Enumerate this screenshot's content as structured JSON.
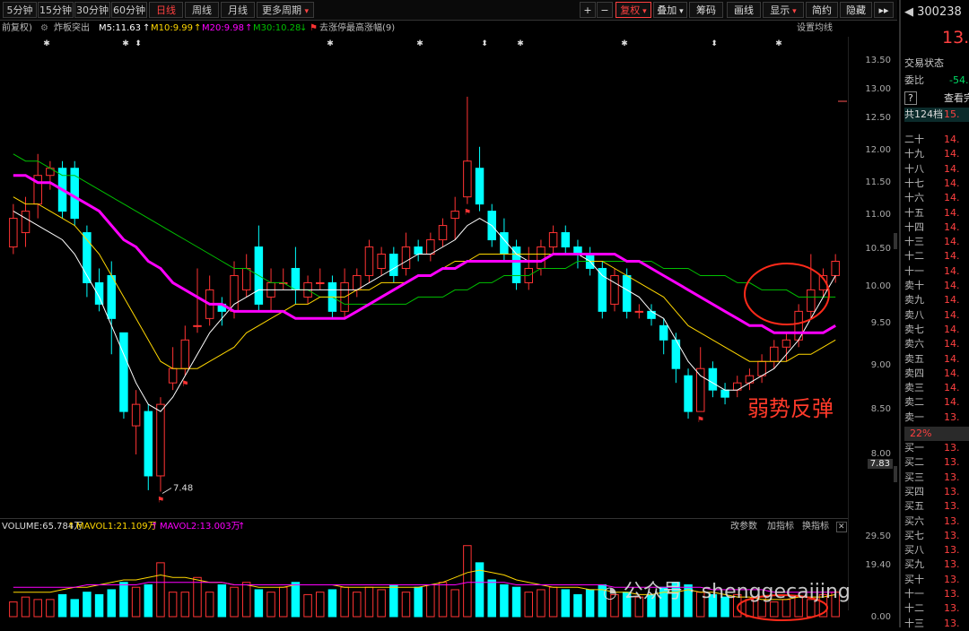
{
  "periods": [
    "5分钟",
    "15分钟",
    "30分钟",
    "60分钟",
    "日线",
    "周线",
    "月线",
    "更多周期"
  ],
  "active_period": "日线",
  "toolbar": {
    "plus": "+",
    "minus": "−",
    "fuquan": "复权",
    "overlay": "叠加",
    "chips": "筹码",
    "draw": "画线",
    "display": "显示",
    "simplify": "简约",
    "hide": "隐藏",
    "more": "▸▸"
  },
  "info": {
    "adjust": "前复权)",
    "stock_pick": "炸板突出",
    "ma5": "M5:11.63",
    "ma10": "M10:9.99",
    "ma20": "M20:9.98",
    "ma30": "M30:10.28",
    "limit_note": "去涨停最高涨幅(9)",
    "setting": "设置均线"
  },
  "colors": {
    "up": "#ff3333",
    "down": "#00ffff",
    "ma5": "#ffffff",
    "ma10": "#ffd700",
    "ma20": "#ff00ff",
    "ma30": "#00c000",
    "vol_ma1": "#ffd700",
    "vol_ma2": "#ff00ff"
  },
  "price_axis": [
    "13.50",
    "13.00",
    "12.50",
    "12.00",
    "11.50",
    "11.00",
    "10.50",
    "10.00",
    "9.50",
    "9.00",
    "8.50",
    "8.00"
  ],
  "current_price_tag": "7.83",
  "low_marker": "7.48",
  "volume": {
    "label": "VOLUME:65.784万",
    "mavol1": "MAVOL1:21.109万",
    "mavol2": "MAVOL2:13.003万",
    "axis": [
      "29.50",
      "19.40",
      "0.00"
    ],
    "controls": [
      "改参数",
      "加指标",
      "换指标"
    ]
  },
  "annotation": "弱势反弹",
  "watermark": "公众号 · shenggecaijing",
  "panel": {
    "code": "300238",
    "price": "13.",
    "trade_state": "交易状态",
    "weibi_label": "委比",
    "weibi_value": "-54.0",
    "help": "?",
    "view": "查看完",
    "levels_label": "共124档",
    "levels_value": "15.",
    "sell_rows": [
      {
        "label": "二十",
        "value": "14."
      },
      {
        "label": "十九",
        "value": "14."
      },
      {
        "label": "十八",
        "value": "14."
      },
      {
        "label": "十七",
        "value": "14."
      },
      {
        "label": "十六",
        "value": "14."
      },
      {
        "label": "十五",
        "value": "14."
      },
      {
        "label": "十四",
        "value": "14."
      },
      {
        "label": "十三",
        "value": "14."
      },
      {
        "label": "十二",
        "value": "14."
      },
      {
        "label": "十一",
        "value": "14."
      },
      {
        "label": "卖十",
        "value": "14."
      },
      {
        "label": "卖九",
        "value": "14."
      },
      {
        "label": "卖八",
        "value": "14."
      },
      {
        "label": "卖七",
        "value": "14."
      },
      {
        "label": "卖六",
        "value": "14."
      },
      {
        "label": "卖五",
        "value": "14."
      },
      {
        "label": "卖四",
        "value": "14."
      },
      {
        "label": "卖三",
        "value": "14."
      },
      {
        "label": "卖二",
        "value": "14."
      },
      {
        "label": "卖一",
        "value": "13."
      }
    ],
    "mid_pct": "22%",
    "buy_rows": [
      {
        "label": "买一",
        "value": "13."
      },
      {
        "label": "买二",
        "value": "13."
      },
      {
        "label": "买三",
        "value": "13."
      },
      {
        "label": "买四",
        "value": "13."
      },
      {
        "label": "买五",
        "value": "13."
      },
      {
        "label": "买六",
        "value": "13."
      },
      {
        "label": "买七",
        "value": "13."
      },
      {
        "label": "买八",
        "value": "13."
      },
      {
        "label": "买九",
        "value": "13."
      },
      {
        "label": "买十",
        "value": "13."
      },
      {
        "label": "十一",
        "value": "13."
      },
      {
        "label": "十二",
        "value": "13."
      },
      {
        "label": "十三",
        "value": "13."
      }
    ]
  },
  "chart_data": {
    "type": "candlestick",
    "ylim": [
      7.4,
      13.6
    ],
    "candles": [
      {
        "o": 10.9,
        "c": 11.3,
        "h": 11.5,
        "l": 10.8
      },
      {
        "o": 11.1,
        "c": 11.4,
        "h": 11.6,
        "l": 10.9
      },
      {
        "o": 11.5,
        "c": 11.9,
        "h": 12.2,
        "l": 11.3
      },
      {
        "o": 11.9,
        "c": 12.0,
        "h": 12.1,
        "l": 11.7
      },
      {
        "o": 12.0,
        "c": 11.4,
        "h": 12.1,
        "l": 11.3
      },
      {
        "o": 12.0,
        "c": 11.3,
        "h": 12.1,
        "l": 11.2
      },
      {
        "o": 11.1,
        "c": 10.4,
        "h": 11.2,
        "l": 10.2
      },
      {
        "o": 10.4,
        "c": 10.1,
        "h": 10.6,
        "l": 10.0
      },
      {
        "o": 10.5,
        "c": 9.9,
        "h": 10.7,
        "l": 9.4
      },
      {
        "o": 9.7,
        "c": 8.6,
        "h": 9.7,
        "l": 8.5
      },
      {
        "o": 8.4,
        "c": 8.7,
        "h": 8.9,
        "l": 8.0
      },
      {
        "o": 8.6,
        "c": 7.7,
        "h": 8.7,
        "l": 7.5
      },
      {
        "o": 7.7,
        "c": 8.7,
        "h": 8.8,
        "l": 7.48
      },
      {
        "o": 9.0,
        "c": 9.2,
        "h": 9.5,
        "l": 8.9
      },
      {
        "o": 9.2,
        "c": 9.6,
        "h": 9.8,
        "l": 9.1
      },
      {
        "o": 9.8,
        "c": 9.8,
        "h": 10.6,
        "l": 9.7
      },
      {
        "o": 9.9,
        "c": 10.3,
        "h": 10.5,
        "l": 9.8
      },
      {
        "o": 10.1,
        "c": 10.0,
        "h": 10.2,
        "l": 9.8
      },
      {
        "o": 10.0,
        "c": 10.5,
        "h": 10.7,
        "l": 9.9
      },
      {
        "o": 10.3,
        "c": 10.6,
        "h": 10.8,
        "l": 10.2
      },
      {
        "o": 10.9,
        "c": 10.1,
        "h": 11.2,
        "l": 10.0
      },
      {
        "o": 10.2,
        "c": 10.4,
        "h": 10.6,
        "l": 10.0
      },
      {
        "o": 10.4,
        "c": 10.4,
        "h": 10.6,
        "l": 10.3
      },
      {
        "o": 10.6,
        "c": 10.3,
        "h": 10.9,
        "l": 10.1
      },
      {
        "o": 10.2,
        "c": 10.4,
        "h": 10.5,
        "l": 10.1
      },
      {
        "o": 10.4,
        "c": 10.4,
        "h": 10.6,
        "l": 10.3
      },
      {
        "o": 10.4,
        "c": 10.0,
        "h": 10.5,
        "l": 9.9
      },
      {
        "o": 10.0,
        "c": 10.4,
        "h": 10.6,
        "l": 9.9
      },
      {
        "o": 10.3,
        "c": 10.5,
        "h": 10.6,
        "l": 10.2
      },
      {
        "o": 10.5,
        "c": 10.9,
        "h": 11.0,
        "l": 10.4
      },
      {
        "o": 10.6,
        "c": 10.8,
        "h": 10.9,
        "l": 10.5
      },
      {
        "o": 10.8,
        "c": 10.5,
        "h": 10.9,
        "l": 10.4
      },
      {
        "o": 10.6,
        "c": 10.9,
        "h": 11.1,
        "l": 10.5
      },
      {
        "o": 10.9,
        "c": 10.8,
        "h": 11.0,
        "l": 10.7
      },
      {
        "o": 10.8,
        "c": 11.0,
        "h": 11.1,
        "l": 10.7
      },
      {
        "o": 11.0,
        "c": 11.2,
        "h": 11.3,
        "l": 10.9
      },
      {
        "o": 11.3,
        "c": 11.4,
        "h": 11.6,
        "l": 11.0
      },
      {
        "o": 11.6,
        "c": 12.1,
        "h": 13.0,
        "l": 11.5
      },
      {
        "o": 12.0,
        "c": 11.5,
        "h": 12.3,
        "l": 11.4
      },
      {
        "o": 11.4,
        "c": 11.0,
        "h": 11.5,
        "l": 10.9
      },
      {
        "o": 11.1,
        "c": 10.8,
        "h": 11.3,
        "l": 10.7
      },
      {
        "o": 10.9,
        "c": 10.4,
        "h": 11.0,
        "l": 10.3
      },
      {
        "o": 10.4,
        "c": 10.6,
        "h": 10.9,
        "l": 10.3
      },
      {
        "o": 10.6,
        "c": 10.9,
        "h": 11.0,
        "l": 10.5
      },
      {
        "o": 10.9,
        "c": 11.1,
        "h": 11.2,
        "l": 10.8
      },
      {
        "o": 11.1,
        "c": 10.9,
        "h": 11.2,
        "l": 10.8
      },
      {
        "o": 10.9,
        "c": 10.8,
        "h": 11.0,
        "l": 10.6
      },
      {
        "o": 10.8,
        "c": 10.6,
        "h": 10.9,
        "l": 10.5
      },
      {
        "o": 10.6,
        "c": 10.0,
        "h": 10.7,
        "l": 9.9
      },
      {
        "o": 10.1,
        "c": 10.5,
        "h": 10.6,
        "l": 10.0
      },
      {
        "o": 10.5,
        "c": 10.0,
        "h": 10.6,
        "l": 9.9
      },
      {
        "o": 10.0,
        "c": 10.0,
        "h": 10.1,
        "l": 9.9
      },
      {
        "o": 10.0,
        "c": 9.9,
        "h": 10.1,
        "l": 9.8
      },
      {
        "o": 9.8,
        "c": 9.6,
        "h": 9.9,
        "l": 9.4
      },
      {
        "o": 9.6,
        "c": 9.2,
        "h": 9.7,
        "l": 9.0
      },
      {
        "o": 9.1,
        "c": 8.6,
        "h": 9.2,
        "l": 8.5
      },
      {
        "o": 8.6,
        "c": 9.2,
        "h": 9.5,
        "l": 8.6
      },
      {
        "o": 9.2,
        "c": 8.9,
        "h": 9.3,
        "l": 8.8
      },
      {
        "o": 8.9,
        "c": 8.8,
        "h": 9.0,
        "l": 8.7
      },
      {
        "o": 8.9,
        "c": 9.0,
        "h": 9.1,
        "l": 8.8
      },
      {
        "o": 9.0,
        "c": 9.1,
        "h": 9.2,
        "l": 8.9
      },
      {
        "o": 9.1,
        "c": 9.3,
        "h": 9.4,
        "l": 9.0
      },
      {
        "o": 9.3,
        "c": 9.5,
        "h": 9.6,
        "l": 9.2
      },
      {
        "o": 9.5,
        "c": 9.6,
        "h": 9.7,
        "l": 9.3
      },
      {
        "o": 9.6,
        "c": 10.0,
        "h": 10.1,
        "l": 9.5
      },
      {
        "o": 10.0,
        "c": 10.3,
        "h": 10.8,
        "l": 9.9
      },
      {
        "o": 10.3,
        "c": 10.5,
        "h": 10.6,
        "l": 10.2
      },
      {
        "o": 10.5,
        "c": 10.7,
        "h": 10.8,
        "l": 10.4
      }
    ],
    "ma_series": [
      {
        "name": "M5",
        "values": [
          11.4,
          11.3,
          11.2,
          11.1,
          11.0,
          10.8,
          10.5,
          10.2,
          9.8,
          9.4,
          9.0,
          8.7,
          8.6,
          8.8,
          9.1,
          9.4,
          9.7,
          9.9,
          10.1,
          10.2,
          10.3,
          10.3,
          10.3,
          10.3,
          10.3,
          10.3,
          10.3,
          10.3,
          10.3,
          10.4,
          10.5,
          10.6,
          10.7,
          10.8,
          10.8,
          10.9,
          11.0,
          11.2,
          11.3,
          11.2,
          11.0,
          10.8,
          10.7,
          10.7,
          10.8,
          10.8,
          10.8,
          10.7,
          10.5,
          10.4,
          10.3,
          10.2,
          10.0,
          9.9,
          9.6,
          9.3,
          9.1,
          9.0,
          8.9,
          8.9,
          9.0,
          9.1,
          9.2,
          9.4,
          9.6,
          9.9,
          10.2,
          10.5
        ]
      },
      {
        "name": "M10",
        "values": [
          11.6,
          11.5,
          11.5,
          11.4,
          11.3,
          11.2,
          11.0,
          10.8,
          10.5,
          10.2,
          9.9,
          9.6,
          9.3,
          9.2,
          9.2,
          9.2,
          9.3,
          9.4,
          9.5,
          9.7,
          9.8,
          9.9,
          10.0,
          10.1,
          10.1,
          10.2,
          10.2,
          10.2,
          10.3,
          10.3,
          10.4,
          10.4,
          10.4,
          10.5,
          10.5,
          10.6,
          10.7,
          10.7,
          10.8,
          10.8,
          10.8,
          10.8,
          10.8,
          10.8,
          10.8,
          10.8,
          10.8,
          10.7,
          10.7,
          10.6,
          10.5,
          10.4,
          10.3,
          10.2,
          10.0,
          9.8,
          9.7,
          9.6,
          9.5,
          9.4,
          9.3,
          9.3,
          9.3,
          9.3,
          9.4,
          9.4,
          9.5,
          9.6
        ]
      },
      {
        "name": "M20",
        "values": [
          11.9,
          11.9,
          11.8,
          11.8,
          11.7,
          11.6,
          11.5,
          11.4,
          11.2,
          11.0,
          10.9,
          10.7,
          10.6,
          10.4,
          10.3,
          10.2,
          10.1,
          10.1,
          10.0,
          10.0,
          10.0,
          10.0,
          10.0,
          9.9,
          9.9,
          9.9,
          9.9,
          9.9,
          10.0,
          10.1,
          10.2,
          10.3,
          10.4,
          10.5,
          10.5,
          10.6,
          10.6,
          10.7,
          10.7,
          10.7,
          10.7,
          10.7,
          10.7,
          10.7,
          10.8,
          10.8,
          10.8,
          10.8,
          10.8,
          10.8,
          10.7,
          10.7,
          10.6,
          10.5,
          10.4,
          10.3,
          10.2,
          10.1,
          10.0,
          9.9,
          9.8,
          9.8,
          9.7,
          9.7,
          9.7,
          9.7,
          9.7,
          9.8
        ]
      },
      {
        "name": "M30",
        "values": [
          12.2,
          12.1,
          12.1,
          12.0,
          11.9,
          11.9,
          11.8,
          11.7,
          11.6,
          11.5,
          11.4,
          11.3,
          11.2,
          11.1,
          11.0,
          10.9,
          10.8,
          10.7,
          10.6,
          10.6,
          10.5,
          10.4,
          10.4,
          10.3,
          10.3,
          10.2,
          10.2,
          10.1,
          10.1,
          10.1,
          10.1,
          10.1,
          10.1,
          10.2,
          10.2,
          10.2,
          10.3,
          10.3,
          10.4,
          10.4,
          10.5,
          10.5,
          10.5,
          10.6,
          10.6,
          10.6,
          10.7,
          10.7,
          10.7,
          10.7,
          10.7,
          10.7,
          10.7,
          10.6,
          10.6,
          10.6,
          10.5,
          10.5,
          10.5,
          10.4,
          10.4,
          10.3,
          10.3,
          10.3,
          10.2,
          10.2,
          10.2,
          10.2
        ]
      }
    ],
    "volumes": [
      6,
      8,
      7,
      7,
      9,
      7,
      10,
      9,
      11,
      14,
      12,
      13,
      22,
      10,
      10,
      16,
      10,
      13,
      12,
      14,
      11,
      10,
      12,
      14,
      9,
      10,
      11,
      12,
      10,
      12,
      11,
      13,
      10,
      12,
      13,
      14,
      11,
      29,
      22,
      15,
      13,
      12,
      10,
      11,
      12,
      11,
      9,
      11,
      13,
      9,
      10,
      8,
      9,
      12,
      14,
      13,
      10,
      9,
      8,
      9,
      7,
      8,
      6,
      7,
      8,
      7,
      9,
      10
    ],
    "mavol1": [
      10,
      10,
      10,
      10,
      11,
      12,
      12,
      13,
      14,
      15,
      15,
      16,
      17,
      16,
      16,
      15,
      14,
      14,
      13,
      13,
      12,
      12,
      12,
      13,
      13,
      13,
      13,
      12,
      12,
      12,
      12,
      12,
      12,
      12,
      13,
      14,
      16,
      18,
      19,
      18,
      17,
      15,
      14,
      13,
      12,
      12,
      12,
      11,
      11,
      10,
      10,
      9,
      9,
      10,
      10,
      11,
      10,
      10,
      9,
      8,
      8,
      7,
      7,
      7,
      8,
      8,
      8,
      9
    ],
    "mavol2": [
      12,
      12,
      12,
      12,
      12,
      12,
      13,
      13,
      13,
      13,
      13,
      14,
      14,
      14,
      14,
      14,
      14,
      14,
      13,
      13,
      13,
      13,
      13,
      13,
      13,
      13,
      13,
      13,
      13,
      13,
      13,
      13,
      13,
      13,
      13,
      13,
      13,
      14,
      14,
      14,
      14,
      13,
      13,
      13,
      13,
      13,
      13,
      13,
      13,
      12,
      12,
      12,
      12,
      12,
      12,
      12,
      12,
      11,
      11,
      11,
      11,
      11,
      10,
      10,
      10,
      10,
      10,
      10
    ],
    "vol_ylim": [
      0,
      30
    ]
  }
}
